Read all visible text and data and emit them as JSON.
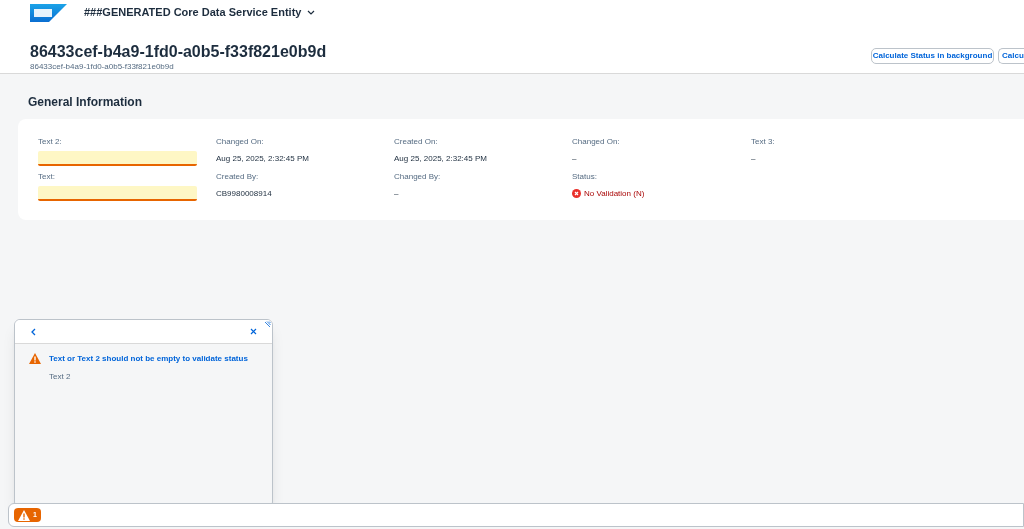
{
  "shell": {
    "app_title": "###GENERATED Core Data Service Entity"
  },
  "header": {
    "title": "86433cef-b4a9-1fd0-a0b5-f33f821e0b9d",
    "subtitle": "86433cef-b4a9-1fd0-a0b5-f33f821e0b9d",
    "actions": [
      "Calculate Status in background",
      "Calcu"
    ]
  },
  "section": {
    "title": "General Information",
    "fields": [
      {
        "label": "Text 2:",
        "kind": "input",
        "warning": true
      },
      {
        "label": "Changed On:",
        "kind": "text",
        "value": "Aug 25, 2025, 2:32:45 PM"
      },
      {
        "label": "Created On:",
        "kind": "text",
        "value": "Aug 25, 2025, 2:32:45 PM"
      },
      {
        "label": "Changed On:",
        "kind": "text",
        "value": "–"
      },
      {
        "label": "Text 3:",
        "kind": "text",
        "value": "–"
      },
      {
        "label": "Text:",
        "kind": "input",
        "warning": true
      },
      {
        "label": "Created By:",
        "kind": "text",
        "value": "CB9980008914"
      },
      {
        "label": "Changed By:",
        "kind": "text",
        "value": "–"
      },
      {
        "label": "Status:",
        "kind": "status",
        "value": "No Validation (N)",
        "error": true
      }
    ]
  },
  "message_popover": {
    "messages": [
      {
        "kind": "warning",
        "title": "Text or Text 2 should not be empty to validate status",
        "subtitle": "Text 2"
      }
    ]
  },
  "footer": {
    "message_button": {
      "kind": "warning",
      "count": "1"
    }
  }
}
